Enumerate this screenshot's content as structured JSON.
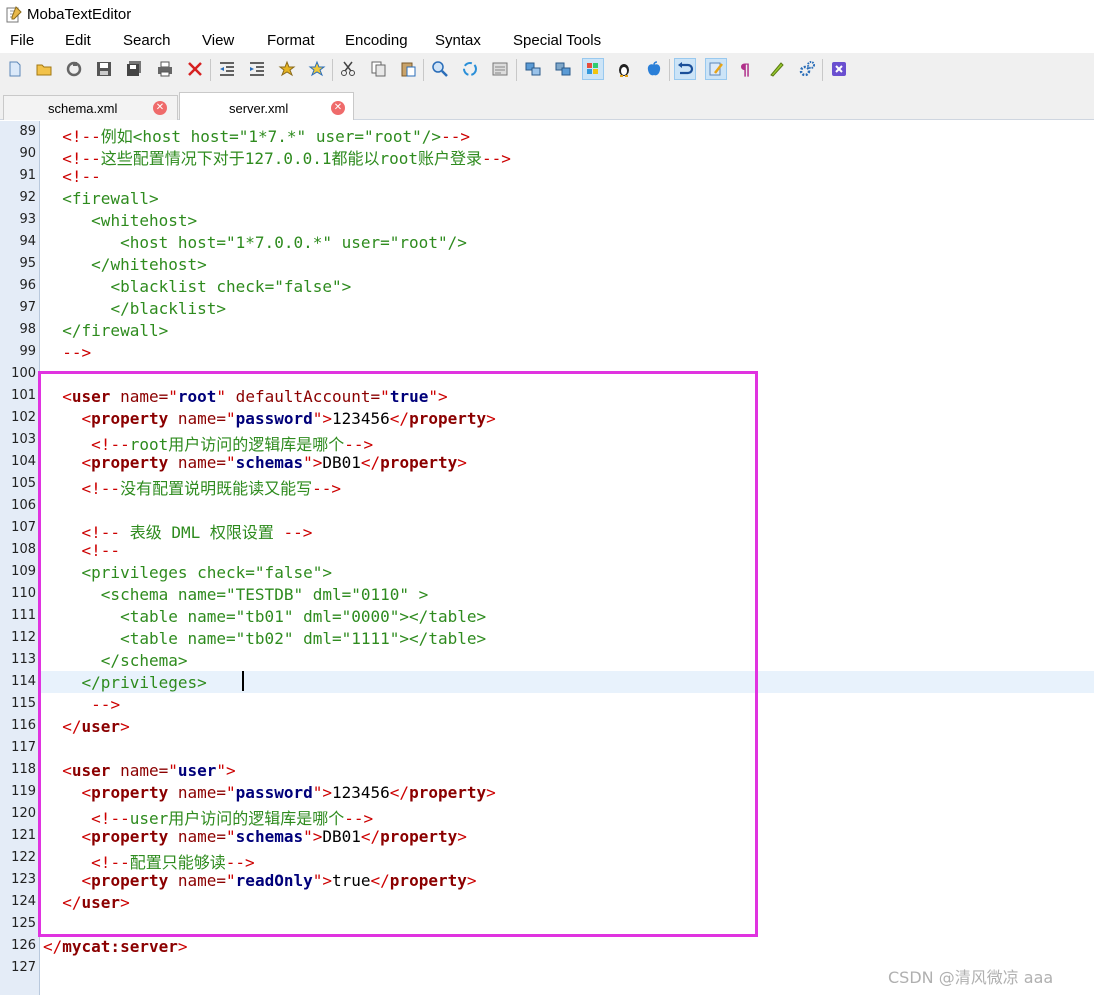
{
  "app": {
    "title": "MobaTextEditor"
  },
  "menu": [
    "File",
    "Edit",
    "Search",
    "View",
    "Format",
    "Encoding",
    "Syntax",
    "Special Tools"
  ],
  "toolbar": {
    "buttons": [
      "new-file-icon",
      "open-folder-icon",
      "reload-icon",
      "save-icon",
      "save-all-icon",
      "print-icon",
      "close-file-icon",
      "unindent-icon",
      "indent-icon",
      "bookmark-icon",
      "bookmark-next-icon",
      "cut-icon",
      "copy-icon",
      "paste-icon",
      "find-icon",
      "replace-icon",
      "goto-icon",
      "split-horizontal-icon",
      "split-vertical-icon",
      "windows-eol-icon",
      "linux-eol-icon",
      "mac-eol-icon",
      "undo-icon",
      "edit-mode-icon",
      "pilcrow-icon",
      "highlighter-icon",
      "settings-icon",
      "exit-icon"
    ]
  },
  "tabs": [
    {
      "label": "schema.xml",
      "active": false
    },
    {
      "label": "server.xml",
      "active": true
    }
  ],
  "editor": {
    "current_line": 114,
    "lines": [
      {
        "num": "89",
        "segs": [
          [
            "i",
            "  "
          ],
          [
            "b",
            "<!--"
          ],
          [
            "c",
            "例如<host host=\"1*7.*\" user=\"root\"/>"
          ],
          [
            "b",
            "-->"
          ]
        ]
      },
      {
        "num": "90",
        "segs": [
          [
            "i",
            "  "
          ],
          [
            "b",
            "<!--"
          ],
          [
            "c",
            "这些配置情况下对于127.0.0.1都能以root账户登录"
          ],
          [
            "b",
            "-->"
          ]
        ]
      },
      {
        "num": "91",
        "segs": [
          [
            "i",
            "  "
          ],
          [
            "b",
            "<!--"
          ]
        ]
      },
      {
        "num": "92",
        "segs": [
          [
            "i",
            "  "
          ],
          [
            "c",
            "<firewall>"
          ]
        ]
      },
      {
        "num": "93",
        "segs": [
          [
            "i",
            "     "
          ],
          [
            "c",
            "<whitehost>"
          ]
        ]
      },
      {
        "num": "94",
        "segs": [
          [
            "i",
            "        "
          ],
          [
            "c",
            "<host host=\"1*7.0.0.*\" user=\"root\"/>"
          ]
        ]
      },
      {
        "num": "95",
        "segs": [
          [
            "i",
            "     "
          ],
          [
            "c",
            "</whitehost>"
          ]
        ]
      },
      {
        "num": "96",
        "segs": [
          [
            "i",
            "       "
          ],
          [
            "c",
            "<blacklist check=\"false\">"
          ]
        ]
      },
      {
        "num": "97",
        "segs": [
          [
            "i",
            "       "
          ],
          [
            "c",
            "</blacklist>"
          ]
        ]
      },
      {
        "num": "98",
        "segs": [
          [
            "i",
            "  "
          ],
          [
            "c",
            "</firewall>"
          ]
        ]
      },
      {
        "num": "99",
        "segs": [
          [
            "i",
            "  "
          ],
          [
            "b",
            "-->"
          ]
        ]
      },
      {
        "num": "100",
        "segs": []
      },
      {
        "num": "101",
        "segs": [
          [
            "i",
            "  "
          ],
          [
            "b",
            "<"
          ],
          [
            "t",
            "user"
          ],
          [
            "a",
            " name="
          ],
          [
            "b",
            "\""
          ],
          [
            "v",
            "root"
          ],
          [
            "b",
            "\""
          ],
          [
            "a",
            " defaultAccount="
          ],
          [
            "b",
            "\""
          ],
          [
            "v",
            "true"
          ],
          [
            "b",
            "\">"
          ]
        ]
      },
      {
        "num": "102",
        "segs": [
          [
            "i",
            "    "
          ],
          [
            "b",
            "<"
          ],
          [
            "t",
            "property"
          ],
          [
            "a",
            " name="
          ],
          [
            "b",
            "\""
          ],
          [
            "v",
            "password"
          ],
          [
            "b",
            "\">"
          ],
          [
            "x",
            "123456"
          ],
          [
            "b",
            "</"
          ],
          [
            "t",
            "property"
          ],
          [
            "b",
            ">"
          ]
        ]
      },
      {
        "num": "103",
        "segs": [
          [
            "i",
            "     "
          ],
          [
            "b",
            "<!--"
          ],
          [
            "c",
            "root用户访问的逻辑库是哪个"
          ],
          [
            "b",
            "-->"
          ]
        ]
      },
      {
        "num": "104",
        "segs": [
          [
            "i",
            "    "
          ],
          [
            "b",
            "<"
          ],
          [
            "t",
            "property"
          ],
          [
            "a",
            " name="
          ],
          [
            "b",
            "\""
          ],
          [
            "v",
            "schemas"
          ],
          [
            "b",
            "\">"
          ],
          [
            "x",
            "DB01"
          ],
          [
            "b",
            "</"
          ],
          [
            "t",
            "property"
          ],
          [
            "b",
            ">"
          ]
        ]
      },
      {
        "num": "105",
        "segs": [
          [
            "i",
            "    "
          ],
          [
            "b",
            "<!--"
          ],
          [
            "c",
            "没有配置说明既能读又能写"
          ],
          [
            "b",
            "-->"
          ]
        ]
      },
      {
        "num": "106",
        "segs": []
      },
      {
        "num": "107",
        "segs": [
          [
            "i",
            "    "
          ],
          [
            "b",
            "<!--"
          ],
          [
            "c",
            " 表级 DML 权限设置 "
          ],
          [
            "b",
            "-->"
          ]
        ]
      },
      {
        "num": "108",
        "segs": [
          [
            "i",
            "    "
          ],
          [
            "b",
            "<!--"
          ]
        ]
      },
      {
        "num": "109",
        "segs": [
          [
            "i",
            "    "
          ],
          [
            "c",
            "<privileges check=\"false\">"
          ]
        ]
      },
      {
        "num": "110",
        "segs": [
          [
            "i",
            "      "
          ],
          [
            "c",
            "<schema name=\"TESTDB\" dml=\"0110\" >"
          ]
        ]
      },
      {
        "num": "111",
        "segs": [
          [
            "i",
            "        "
          ],
          [
            "c",
            "<table name=\"tb01\" dml=\"0000\"></table>"
          ]
        ]
      },
      {
        "num": "112",
        "segs": [
          [
            "i",
            "        "
          ],
          [
            "c",
            "<table name=\"tb02\" dml=\"1111\"></table>"
          ]
        ]
      },
      {
        "num": "113",
        "segs": [
          [
            "i",
            "      "
          ],
          [
            "c",
            "</schema>"
          ]
        ]
      },
      {
        "num": "114",
        "segs": [
          [
            "i",
            "    "
          ],
          [
            "c",
            "</privileges>"
          ]
        ]
      },
      {
        "num": "115",
        "segs": [
          [
            "i",
            "     "
          ],
          [
            "b",
            "-->"
          ]
        ]
      },
      {
        "num": "116",
        "segs": [
          [
            "i",
            "  "
          ],
          [
            "b",
            "</"
          ],
          [
            "t",
            "user"
          ],
          [
            "b",
            ">"
          ]
        ]
      },
      {
        "num": "117",
        "segs": []
      },
      {
        "num": "118",
        "segs": [
          [
            "i",
            "  "
          ],
          [
            "b",
            "<"
          ],
          [
            "t",
            "user"
          ],
          [
            "a",
            " name="
          ],
          [
            "b",
            "\""
          ],
          [
            "v",
            "user"
          ],
          [
            "b",
            "\">"
          ]
        ]
      },
      {
        "num": "119",
        "segs": [
          [
            "i",
            "    "
          ],
          [
            "b",
            "<"
          ],
          [
            "t",
            "property"
          ],
          [
            "a",
            " name="
          ],
          [
            "b",
            "\""
          ],
          [
            "v",
            "password"
          ],
          [
            "b",
            "\">"
          ],
          [
            "x",
            "123456"
          ],
          [
            "b",
            "</"
          ],
          [
            "t",
            "property"
          ],
          [
            "b",
            ">"
          ]
        ]
      },
      {
        "num": "120",
        "segs": [
          [
            "i",
            "     "
          ],
          [
            "b",
            "<!--"
          ],
          [
            "c",
            "user用户访问的逻辑库是哪个"
          ],
          [
            "b",
            "-->"
          ]
        ]
      },
      {
        "num": "121",
        "segs": [
          [
            "i",
            "    "
          ],
          [
            "b",
            "<"
          ],
          [
            "t",
            "property"
          ],
          [
            "a",
            " name="
          ],
          [
            "b",
            "\""
          ],
          [
            "v",
            "schemas"
          ],
          [
            "b",
            "\">"
          ],
          [
            "x",
            "DB01"
          ],
          [
            "b",
            "</"
          ],
          [
            "t",
            "property"
          ],
          [
            "b",
            ">"
          ]
        ]
      },
      {
        "num": "122",
        "segs": [
          [
            "i",
            "     "
          ],
          [
            "b",
            "<!--"
          ],
          [
            "c",
            "配置只能够读"
          ],
          [
            "b",
            "-->"
          ]
        ]
      },
      {
        "num": "123",
        "segs": [
          [
            "i",
            "    "
          ],
          [
            "b",
            "<"
          ],
          [
            "t",
            "property"
          ],
          [
            "a",
            " name="
          ],
          [
            "b",
            "\""
          ],
          [
            "v",
            "readOnly"
          ],
          [
            "b",
            "\">"
          ],
          [
            "x",
            "true"
          ],
          [
            "b",
            "</"
          ],
          [
            "t",
            "property"
          ],
          [
            "b",
            ">"
          ]
        ]
      },
      {
        "num": "124",
        "segs": [
          [
            "i",
            "  "
          ],
          [
            "b",
            "</"
          ],
          [
            "t",
            "user"
          ],
          [
            "b",
            ">"
          ]
        ]
      },
      {
        "num": "125",
        "segs": []
      },
      {
        "num": "126",
        "segs": [
          [
            "b",
            "</"
          ],
          [
            "t",
            "mycat:server"
          ],
          [
            "b",
            ">"
          ]
        ]
      },
      {
        "num": "127",
        "segs": []
      }
    ]
  },
  "watermark": "CSDN @清风微凉 aaa",
  "colors": {
    "highlight_box": "#e033e0",
    "gutter": "#e4ecf7",
    "current_line": "#e8f2fc"
  }
}
